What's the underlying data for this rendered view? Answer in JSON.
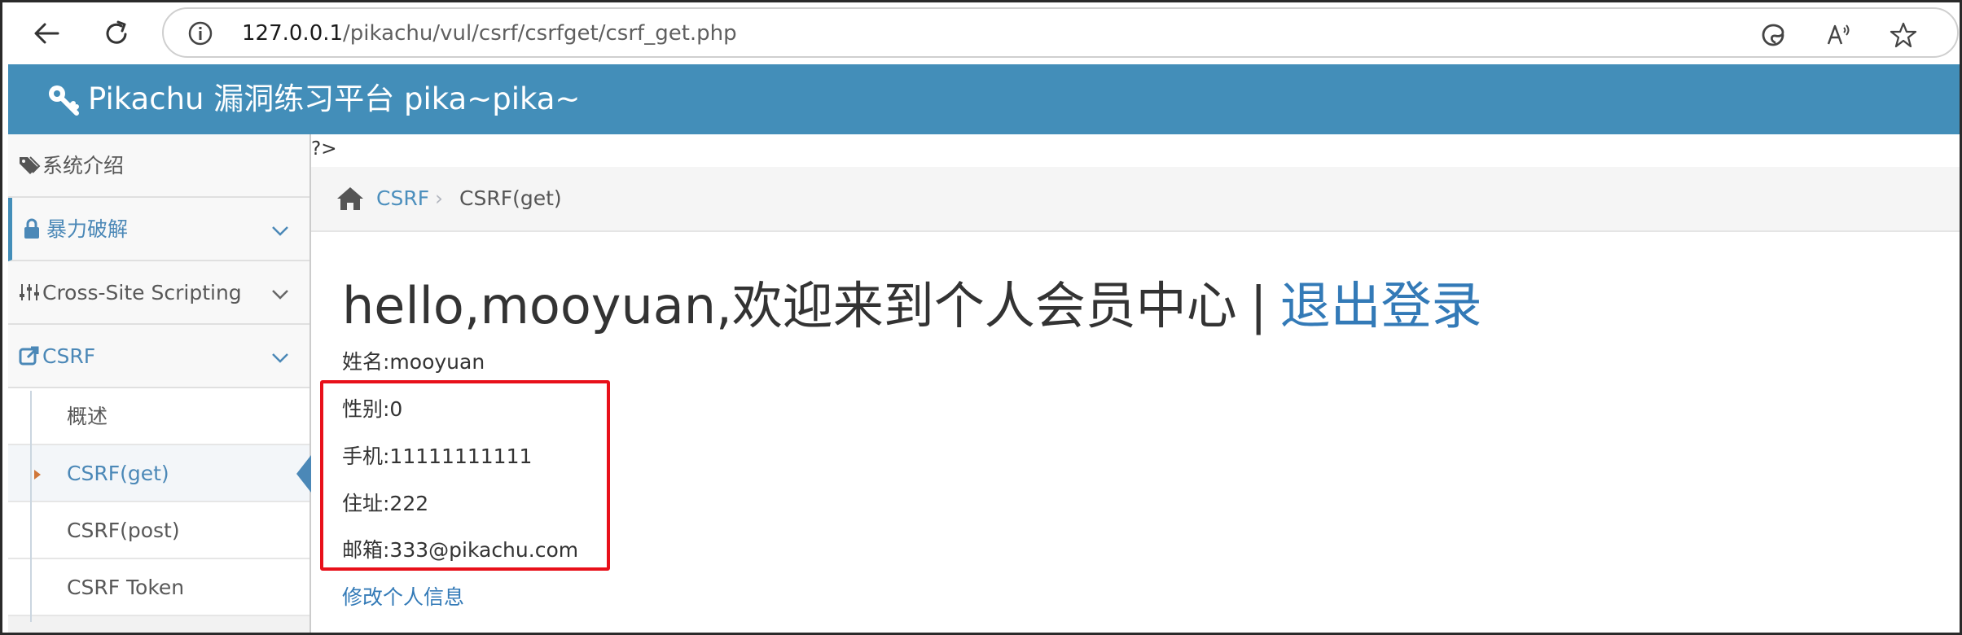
{
  "browser": {
    "url_host": "127.0.0.1",
    "url_path": "/pikachu/vul/csrf/csrfget/csrf_get.php"
  },
  "header": {
    "title": "Pikachu 漏洞练习平台 pika~pika~"
  },
  "sidebar": {
    "items": [
      {
        "label": "系统介绍",
        "icon": "tags-icon"
      },
      {
        "label": "暴力破解",
        "icon": "lock-icon"
      },
      {
        "label": "Cross-Site Scripting",
        "icon": "sliders-icon"
      },
      {
        "label": "CSRF",
        "icon": "share-square-icon"
      }
    ],
    "subitems": [
      {
        "label": "概述"
      },
      {
        "label": "CSRF(get)"
      },
      {
        "label": "CSRF(post)"
      },
      {
        "label": "CSRF Token"
      }
    ]
  },
  "content": {
    "php_tag": "?>",
    "breadcrumb": {
      "section": "CSRF",
      "current": "CSRF(get)"
    },
    "welcome_text": "hello,mooyuan,欢迎来到个人会员中心",
    "separator": "|",
    "logout_label": "退出登录",
    "fields": [
      "姓名:mooyuan",
      "性别:0",
      "手机:11111111111",
      "住址:222",
      "邮箱:333@pikachu.com"
    ],
    "edit_label": "修改个人信息"
  },
  "colors": {
    "header_blue": "#438eb9",
    "link_blue": "#337ab7",
    "highlight_red": "#e8101a"
  }
}
